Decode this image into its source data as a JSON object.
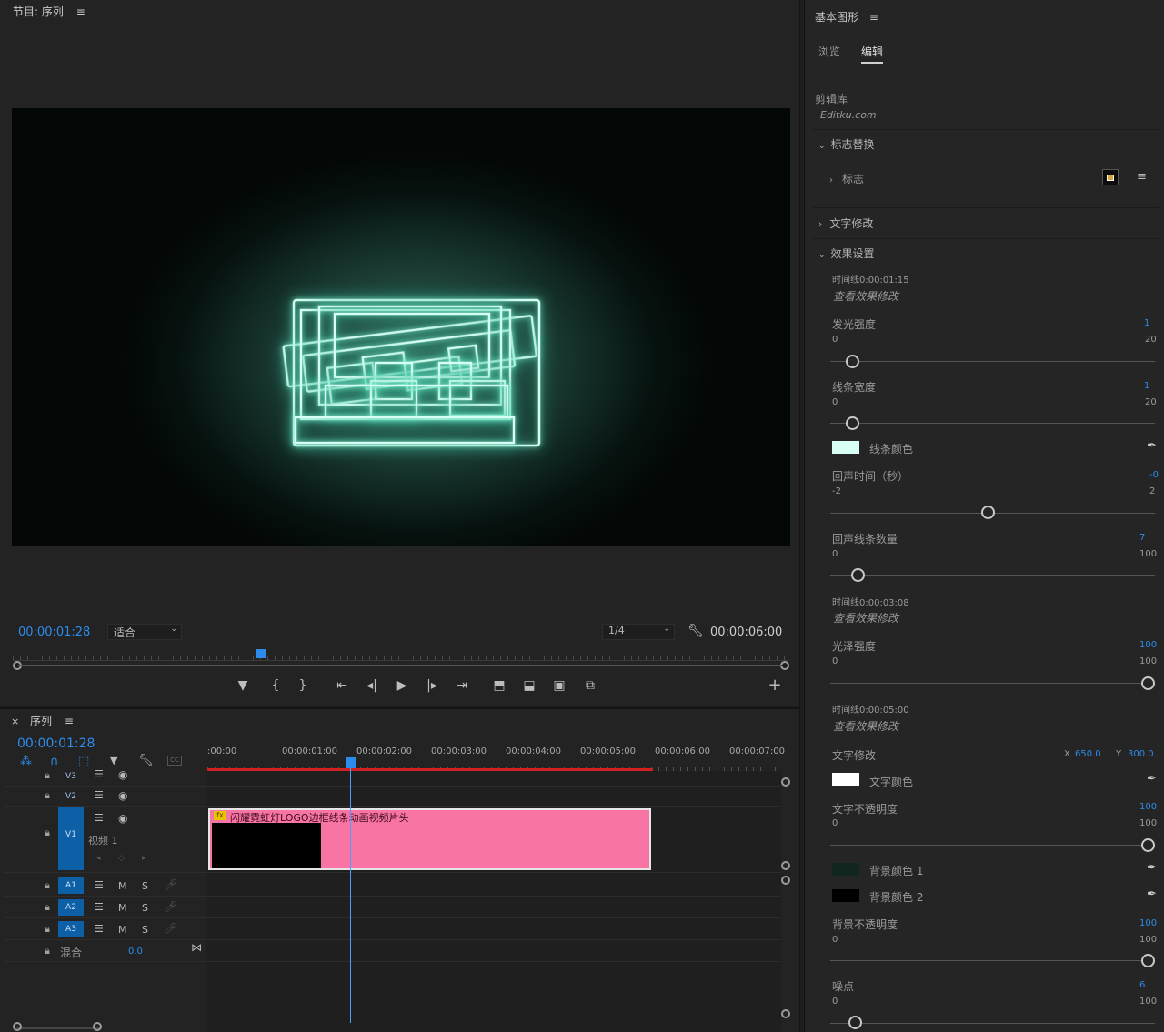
{
  "program": {
    "title": "节目: 序列",
    "menu_icon": "≡",
    "timecode_current": "00:00:01:28",
    "fit_label": "适合",
    "resolution_label": "1/4",
    "timecode_duration": "00:00:06:00",
    "playhead_progress": 0.32
  },
  "timeline": {
    "close": "×",
    "title": "序列",
    "menu_icon": "≡",
    "timecode": "00:00:01:28",
    "ruler": [
      ":00:00",
      "00:00:01:00",
      "00:00:02:00",
      "00:00:03:00",
      "00:00:04:00",
      "00:00:05:00",
      "00:00:06:00",
      "00:00:07:00"
    ],
    "video_tracks": [
      {
        "id": "V3"
      },
      {
        "id": "V2"
      },
      {
        "id": "V1",
        "name": "视频 1"
      }
    ],
    "audio_tracks": [
      {
        "id": "A1",
        "m": "M",
        "s": "S"
      },
      {
        "id": "A2",
        "m": "M",
        "s": "S"
      },
      {
        "id": "A3",
        "m": "M",
        "s": "S"
      }
    ],
    "mix": {
      "label": "混合",
      "value": "0.0"
    },
    "clip": {
      "fx": "fx",
      "name": "闪耀霓虹灯LOGO边框线条动画视频片头"
    }
  },
  "eg": {
    "title": "基本图形",
    "menu_icon": "≡",
    "tabs": [
      "浏览",
      "编辑"
    ],
    "active_tab": "编辑",
    "library_label": "剪辑库",
    "library_site": "Editku.com",
    "sections": {
      "logo_replace": "标志替换",
      "logo": "标志",
      "text_edit": "文字修改",
      "effect_settings": "效果设置"
    },
    "timeline_notes": [
      {
        "label": "时间线0:00:01:15",
        "note": "查看效果修改"
      },
      {
        "label": "时间线0:00:03:08",
        "note": "查看效果修改"
      },
      {
        "label": "时间线0:00:05:00",
        "note": "查看效果修改"
      }
    ],
    "params": {
      "glow": {
        "label": "发光强度",
        "value": "1",
        "min": "0",
        "max": "20"
      },
      "line_width": {
        "label": "线条宽度",
        "value": "1",
        "min": "0",
        "max": "20"
      },
      "line_color": {
        "label": "线条颜色",
        "color": "#d8fff6"
      },
      "echo_time": {
        "label": "回声时间（秒）",
        "value": "-0",
        "min": "-2",
        "max": "2"
      },
      "echo_count": {
        "label": "回声线条数量",
        "value": "7",
        "min": "0",
        "max": "100"
      },
      "gloss": {
        "label": "光泽强度",
        "value": "100",
        "min": "0",
        "max": "100"
      },
      "text_edit": {
        "label": "文字修改",
        "x_label": "X",
        "x": "650.0",
        "y_label": "Y",
        "y": "300.0"
      },
      "text_color": {
        "label": "文字颜色",
        "color": "#ffffff"
      },
      "text_opacity": {
        "label": "文字不透明度",
        "value": "100",
        "min": "0",
        "max": "100"
      },
      "bg_color1": {
        "label": "背景颜色 1",
        "color": "#10261f"
      },
      "bg_color2": {
        "label": "背景颜色 2",
        "color": "#000000"
      },
      "bg_opacity": {
        "label": "背景不透明度",
        "value": "100",
        "min": "0",
        "max": "100"
      },
      "noise": {
        "label": "噪点",
        "value": "6",
        "min": "0",
        "max": "100"
      }
    }
  }
}
